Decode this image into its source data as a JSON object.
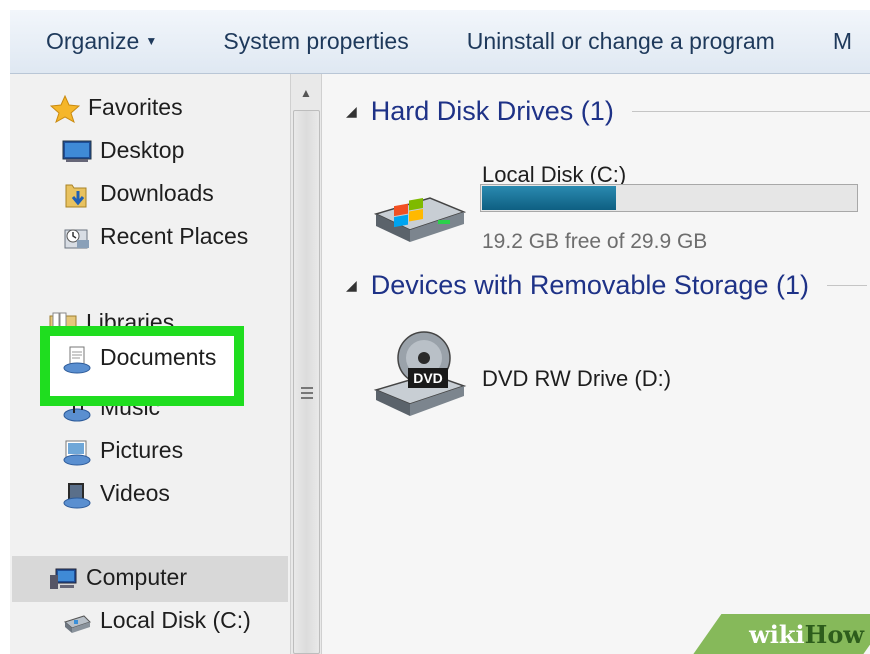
{
  "toolbar": {
    "organize": "Organize",
    "system_properties": "System properties",
    "uninstall": "Uninstall or change a program",
    "overflow": "M"
  },
  "nav": {
    "favorites": {
      "label": "Favorites",
      "items": [
        "Desktop",
        "Downloads",
        "Recent Places"
      ]
    },
    "libraries": {
      "label": "Libraries",
      "items": [
        "Documents",
        "Music",
        "Pictures",
        "Videos"
      ]
    },
    "computer": {
      "label": "Computer",
      "items": [
        "Local Disk (C:)"
      ]
    }
  },
  "content": {
    "hard_disk_header": "Hard Disk Drives (1)",
    "local_disk": {
      "name": "Local Disk (C:)",
      "free_text": "19.2 GB free of 29.9 GB",
      "used_fraction": 0.358
    },
    "removable_header": "Devices with Removable Storage (1)",
    "dvd": {
      "name": "DVD RW Drive (D:)",
      "badge": "DVD"
    }
  },
  "watermark": {
    "wiki": "wiki",
    "how": "How"
  },
  "colors": {
    "highlight": "#1fdd1f",
    "header": "#1e3287",
    "bar": "#1b6f95"
  }
}
